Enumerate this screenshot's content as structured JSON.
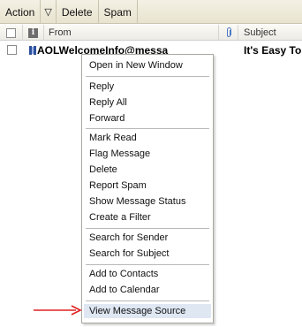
{
  "toolbar": {
    "action_label": "Action",
    "delete_label": "Delete",
    "spam_label": "Spam"
  },
  "columns": {
    "from_label": "From",
    "subject_label": "Subject"
  },
  "message": {
    "from": "AOLWelcomeInfo@messa",
    "subject": "It's Easy To"
  },
  "context_menu": {
    "items": [
      "Open in New Window",
      "Reply",
      "Reply All",
      "Forward",
      "Mark Read",
      "Flag Message",
      "Delete",
      "Report Spam",
      "Show Message Status",
      "Create a Filter",
      "Search for Sender",
      "Search for Subject",
      "Add to Contacts",
      "Add to Calendar",
      "View Message Source"
    ],
    "highlighted_item": "View Message Source"
  },
  "icons": {
    "action_dropdown": "chevron-down-icon",
    "info_column": "info-icon",
    "attachment_column": "paperclip-icon",
    "message_type": "message-icon",
    "pointer": "red-arrow-icon"
  },
  "colors": {
    "toolbar_bg": "#ece7d4",
    "menu_highlight": "#dfe7f3",
    "arrow": "#e02020"
  }
}
